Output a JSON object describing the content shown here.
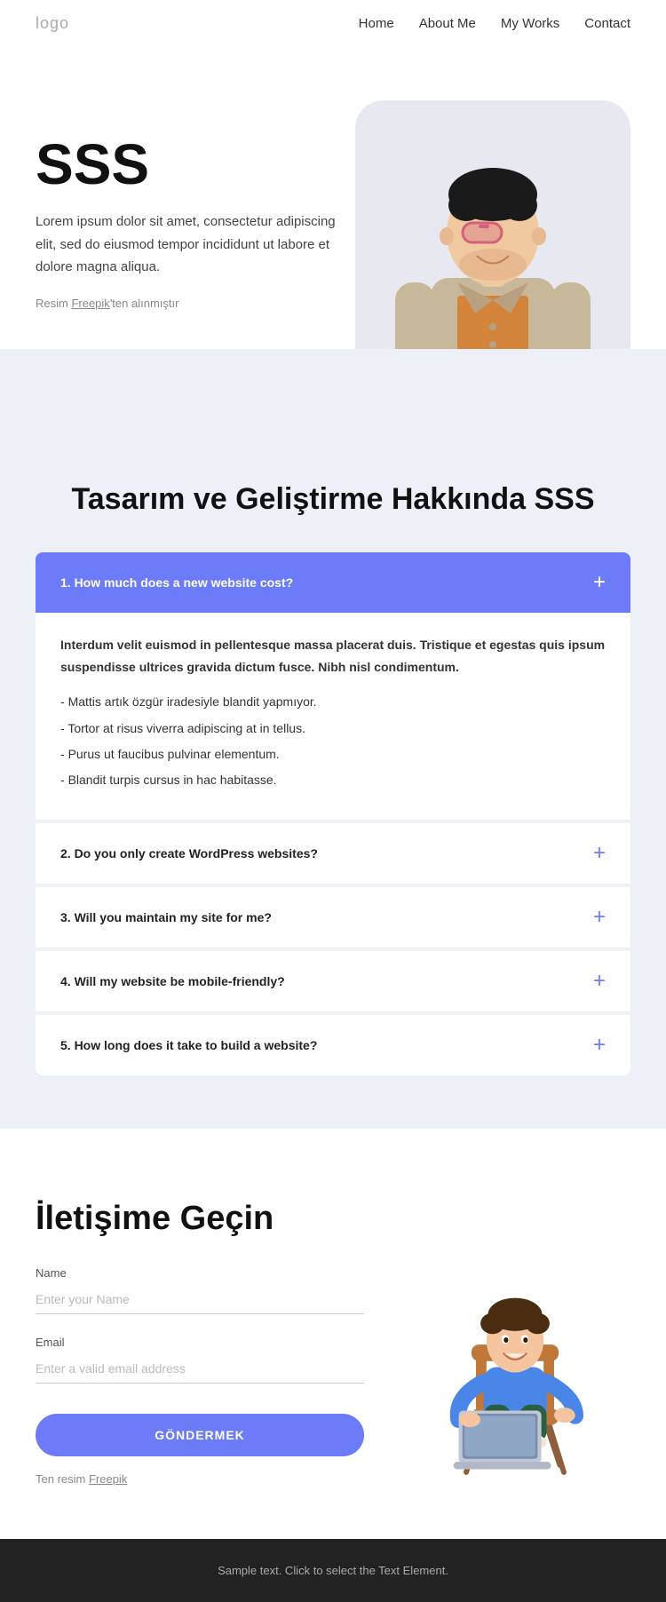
{
  "nav": {
    "logo": "logo",
    "links": [
      {
        "label": "Home",
        "href": "#"
      },
      {
        "label": "About Me",
        "href": "#"
      },
      {
        "label": "My Works",
        "href": "#"
      },
      {
        "label": "Contact",
        "href": "#"
      }
    ]
  },
  "hero": {
    "title": "SSS",
    "description": "Lorem ipsum dolor sit amet, consectetur adipiscing elit, sed do eiusmod tempor incididunt ut labore et dolore magna aliqua.",
    "credit_prefix": "Resim ",
    "credit_link": "Freepik",
    "credit_suffix": "'ten alınmıştır"
  },
  "faq": {
    "title": "Tasarım ve Geliştirme Hakkında SSS",
    "items": [
      {
        "id": 1,
        "question": "1. How much does a new website cost?",
        "answer_bold": "Interdum velit euismod in pellentesque massa placerat duis. Tristique et egestas quis ipsum suspendisse ultrices gravida dictum fusce. Nibh nisl condimentum.",
        "answer_list": [
          "Mattis artık özgür iradesiyle blandit yapmıyor.",
          "Tortor at risus viverra adipiscing at in tellus.",
          "Purus ut faucibus pulvinar elementum.",
          "Blandit turpis cursus in hac habitasse."
        ],
        "open": true
      },
      {
        "id": 2,
        "question": "2. Do you only create WordPress websites?",
        "answer_bold": "",
        "answer_list": [],
        "open": false
      },
      {
        "id": 3,
        "question": "3. Will you maintain my site for me?",
        "answer_bold": "",
        "answer_list": [],
        "open": false
      },
      {
        "id": 4,
        "question": "4. Will my website be mobile-friendly?",
        "answer_bold": "",
        "answer_list": [],
        "open": false
      },
      {
        "id": 5,
        "question": "5. How long does it take to build a website?",
        "answer_bold": "",
        "answer_list": [],
        "open": false
      }
    ]
  },
  "contact": {
    "title": "İletişime Geçin",
    "name_label": "Name",
    "name_placeholder": "Enter your Name",
    "email_label": "Email",
    "email_placeholder": "Enter a valid email address",
    "submit_label": "GÖNDERMEK",
    "credit_prefix": "Ten resim ",
    "credit_link": "Freepik"
  },
  "footer": {
    "text": "Sample text. Click to select the Text Element."
  }
}
